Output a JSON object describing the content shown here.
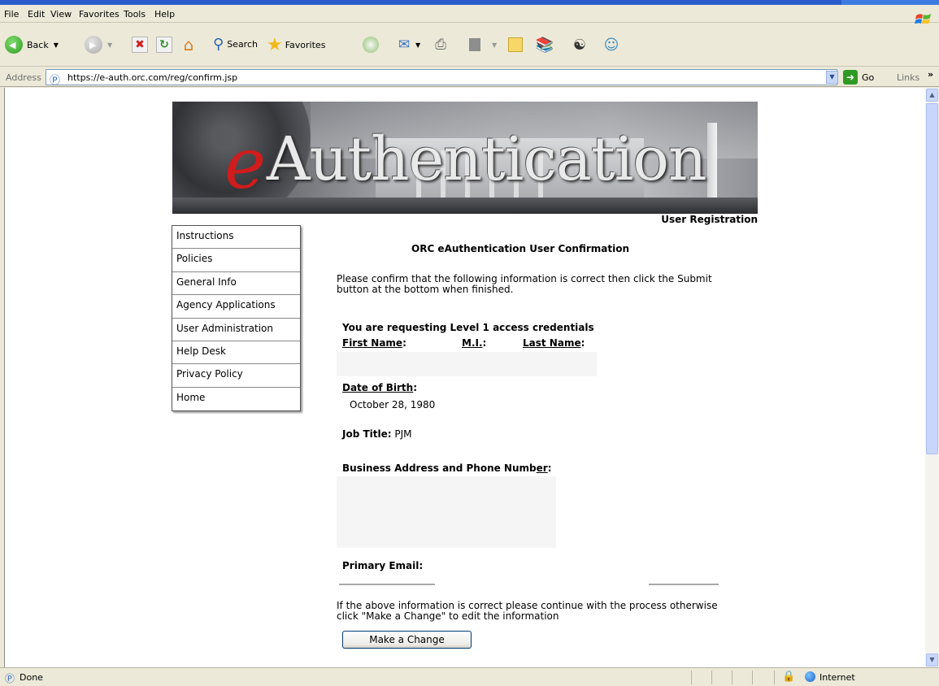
{
  "menu": [
    "File",
    "Edit",
    "View",
    "Favorites",
    "Tools",
    "Help"
  ],
  "toolbar": {
    "back_label": "Back",
    "search_label": "Search",
    "favorites_label": "Favorites"
  },
  "address": {
    "label": "Address",
    "url": "https://e-auth.orc.com/reg/confirm.jsp",
    "go_label": "Go",
    "links_label": "Links"
  },
  "banner": {
    "logo_e": "e",
    "logo_rest": "Authentication",
    "page_heading": "User Registration"
  },
  "nav": [
    "Instructions",
    "Policies",
    "General Info",
    "Agency Applications",
    "User Administration",
    "Help Desk",
    "Privacy Policy",
    "Home"
  ],
  "content": {
    "title": "ORC eAuthentication User Confirmation",
    "intro": "Please confirm that the following information is correct then click the Submit button at the bottom when finished.",
    "level": "You are requesting Level 1 access credentials",
    "first_name_label": "First Name",
    "mi_label": "M.I.",
    "last_name_label": "Last Name",
    "dob_label": "Date of Birth",
    "dob_value": "October 28, 1980",
    "job_title_label": "Job Title:",
    "job_title_value": "PJM",
    "business_label_1": "Business Address and Phone Numb",
    "business_label_2": "er",
    "email_label": "Primary Email:",
    "closing": "If the above information is correct please continue with the process otherwise click \"Make a Change\" to edit the information",
    "change_button": "Make a Change"
  },
  "status": {
    "left": "Done",
    "zone": "Internet"
  },
  "colors": {
    "logo_red": "#d01c1c",
    "chrome": "#ece9d8",
    "link_border": "#003c74"
  }
}
